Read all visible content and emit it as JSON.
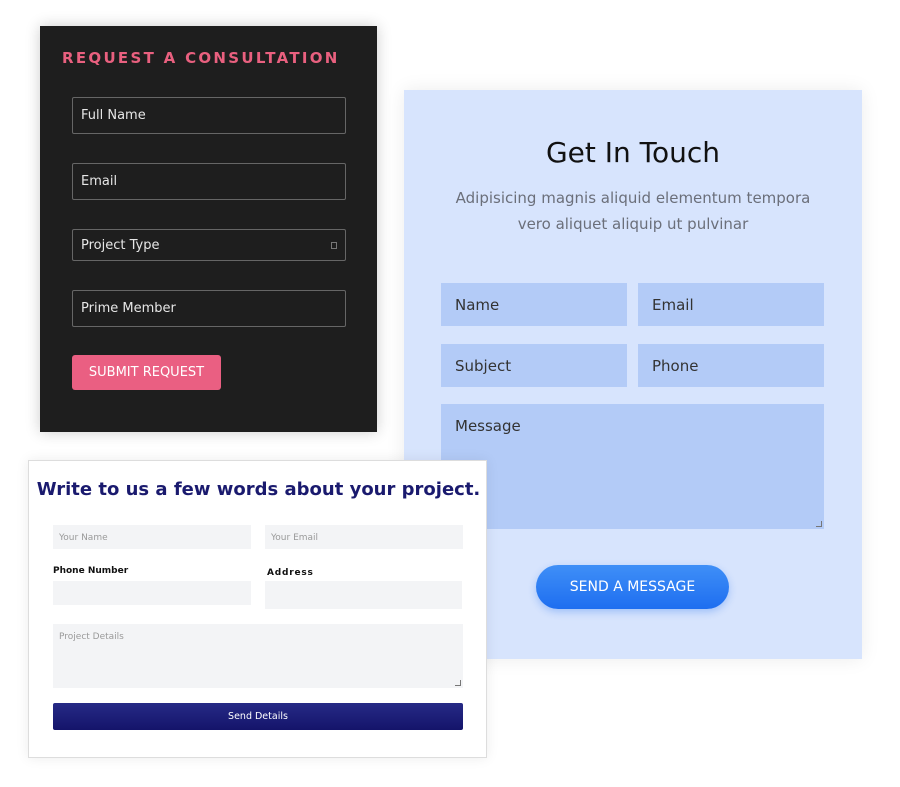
{
  "get_in_touch": {
    "title": "Get In Touch",
    "subtitle": "Adipisicing magnis aliquid elementum tempora vero aliquet aliquip ut pulvinar",
    "fields": {
      "name": "Name",
      "email": "Email",
      "subject": "Subject",
      "phone": "Phone",
      "message": "Message"
    },
    "button": "SEND A MESSAGE"
  },
  "consultation": {
    "title": "REQUEST A CONSULTATION",
    "fields": {
      "full_name": "Full Name",
      "email": "Email",
      "project_type": "Project Type",
      "prime_member": "Prime Member"
    },
    "button": "SUBMIT REQUEST"
  },
  "project_form": {
    "title": "Write to us a few words about your project.",
    "fields": {
      "your_name": "Your Name",
      "your_email": "Your Email",
      "project_details": "Project Details"
    },
    "labels": {
      "phone": "Phone Number",
      "address": "Address"
    },
    "button": "Send Details"
  },
  "colors": {
    "pink": "#e9607f",
    "navy": "#1a1a6e",
    "blue": "#1e6ef0",
    "panel_blue": "#d7e4fd"
  }
}
